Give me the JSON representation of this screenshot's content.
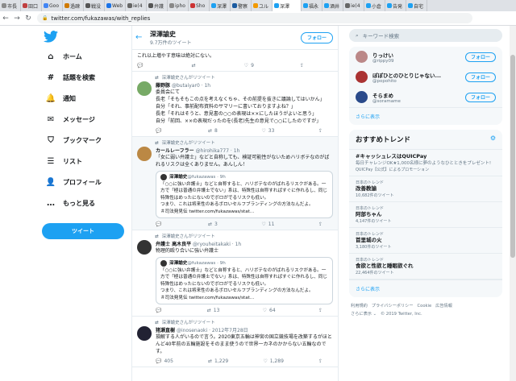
{
  "browser": {
    "tabs": [
      "市長",
      "田口",
      "Goo",
      "過疎",
      "戦没",
      "Web",
      "ie(4",
      "弁護",
      "ipho",
      "Sho",
      "深澤",
      "警察",
      "ユル",
      "深澤",
      "福永",
      "酒井",
      "ie(4",
      "小倉",
      "告発",
      "自宅"
    ],
    "tab_colors": [
      "#8a8a8a",
      "#c04040",
      "#4285f4",
      "#d07a00",
      "#555",
      "#1a73e8",
      "#666",
      "#555",
      "#888",
      "#c33",
      "#1da1f2",
      "#1a5aa0",
      "#f29900",
      "#1da1f2",
      "#1da1f2",
      "#1da1f2",
      "#666",
      "#1da1f2",
      "#1da1f2",
      "#1da1f2"
    ],
    "active_tab": 13,
    "url": "twitter.com/fukazawas/with_replies"
  },
  "sidebar": {
    "items": [
      {
        "label": "ホーム",
        "icon": "⌂"
      },
      {
        "label": "話題を検索",
        "icon": "#"
      },
      {
        "label": "通知",
        "icon": "🔔"
      },
      {
        "label": "メッセージ",
        "icon": "✉"
      },
      {
        "label": "ブックマーク",
        "icon": "⛉"
      },
      {
        "label": "リスト",
        "icon": "☰"
      },
      {
        "label": "プロフィール",
        "icon": "👤"
      },
      {
        "label": "もっと見る",
        "icon": "…"
      }
    ],
    "tweet_button": "ツイート"
  },
  "profile": {
    "name": "深澤諭史",
    "tweets": "9.7万件のツイート",
    "follow": "フォロー"
  },
  "tweets": [
    {
      "top_text": "これ以上増やす意味は絶対にない。",
      "reply": "",
      "retweet": "",
      "like": "9"
    },
    {
      "rt": "深澤諭史さんがリツイート",
      "name": "藤野豚",
      "handle": "@butaiyar0 · 1h",
      "text": "委員会にて\n長老「そもそもこの点を考えなくちゃ、その前提を抜きに議論してはいかん」\n自分「それ、事前配布資料のサマリーに書いておりますよね？」\n長老「それはそうと、意見書の○○の表現は××にしたほうがよいと思う」\n自分「前回、××の表現だったのを(長老)先生の意見で○○にしたのですが」",
      "reply": "",
      "retweet": "8",
      "like": "33"
    },
    {
      "rt": "深澤諭史さんがリツイート",
      "name": "カールレーフラー",
      "handle": "@hirohika777 · 1h",
      "text": "「女に弱い弁護士」などと自称しても、検証可能性がないためハリボテなのがばれるリスクは全くありません。あんしん！",
      "quote": {
        "name": "深澤諭史",
        "handle": "@fukazawas · 9h",
        "text": "「○○に強い弁護士」などと自称すると、ハリボテなのがばれるリスクがある。一方で「極は普通の弁護士でない」系は、特殊性は自称すればすぐに作れるし、同じ特殊性はめったにないのでボロがでるリスクも低い。\nつまり、これは将来性のあるボロいセルフブランディングの方法なんだよ。\n＃司法発見伝 twitter.com/fukazawas/stat..."
      },
      "reply": "",
      "retweet": "3",
      "like": "11"
    },
    {
      "rt": "深澤諭史さんがリツイート",
      "name": "弁護士 高木良平",
      "handle": "@ryouheitakaki · 1h",
      "text": "物理的殴り合いに強い弁護士",
      "quote": {
        "name": "深澤諭史",
        "handle": "@fukazawas · 9h",
        "text": "「○○に強い弁護士」などと自称すると、ハリボテなのがばれるリスクがある。一方で「極は普通の弁護士でない」系は、特殊性は自称すればすぐに作れるし、同じ特殊性はめったにないのでボロがでるリスクも低い。\nつまり、これは将来性のあるボロいセルフブランディングの方法なんだよ。\n＃司法発見伝 twitter.com/fukazawas/stat..."
      },
      "reply": "",
      "retweet": "13",
      "like": "64"
    },
    {
      "rt": "深澤諭史さんがリツイート",
      "name": "猪瀬直樹",
      "handle": "@inosenaoki · 2012年7月28日",
      "text": "損解する人がいるので言う。2020東京五輪は神宮の国立競技場を改築するがほとんど40年前の五輪施設をそのまま使うので世界一カネのかからない五輪なのです。",
      "reply": "405",
      "retweet": "1,229",
      "like": "1,289"
    }
  ],
  "search": {
    "placeholder": "キーワード検索"
  },
  "follows": [
    {
      "name": "りっけい",
      "handle": "@rippy09",
      "btn": "フォロー",
      "color": "#b88"
    },
    {
      "name": "ぽぽひとのひとりじゃない...",
      "handle": "@popohito",
      "btn": "フォロー",
      "color": "#a33"
    },
    {
      "name": "そらまめ",
      "handle": "@soramame",
      "btn": "フォロー",
      "color": "#2a4a8a"
    }
  ],
  "follows_more": "さらに表示",
  "trends": {
    "title": "おすすめトレンド",
    "items": [
      {
        "cat": "",
        "title": "#キャッシュレスはQUICPay",
        "desc": "毎日チャレンジOK★1,000名様に夢のようなひとときをプレゼント!",
        "count": "QUICPay【公式】によるプロモーション"
      },
      {
        "cat": "日本のトレンド",
        "title": "改善教諭",
        "desc": "",
        "count": "10,682件のツイート"
      },
      {
        "cat": "日本のトレンド",
        "title": "阿部ちゃん",
        "desc": "",
        "count": "4,147件のツイート"
      },
      {
        "cat": "日本のトレンド",
        "title": "首里城の火",
        "desc": "",
        "count": "3,180件のツイート"
      },
      {
        "cat": "日本のトレンド",
        "title": "食欲と性欲と睡眠欲ぐれ",
        "desc": "",
        "count": "22,464件のツイート"
      }
    ],
    "more": "さらに表示"
  },
  "footer": [
    "利用規約",
    "プライバシーポリシー",
    "Cookie",
    "広告情報",
    "さらに表示 ⌄",
    "© 2019 Twitter, Inc."
  ]
}
